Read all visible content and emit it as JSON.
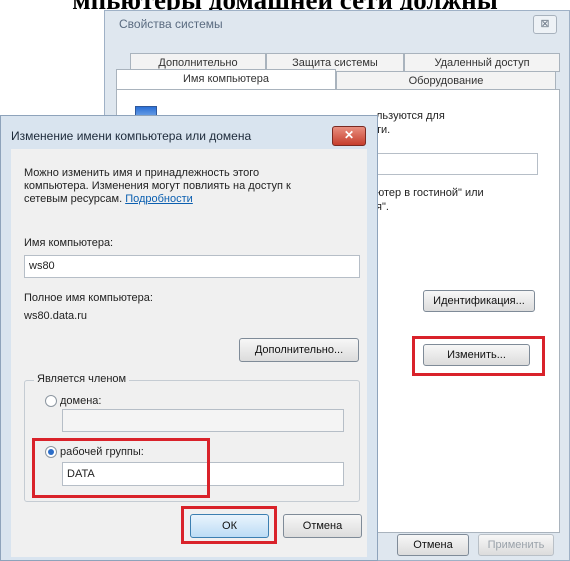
{
  "heading": "мпьютеры домашней сети должны ",
  "back_window": {
    "title": "Свойства системы",
    "close_label": "⊠",
    "tabs_row1": [
      "Дополнительно",
      "Защита системы",
      "Удаленный доступ"
    ],
    "tabs_row2": [
      "Имя компьютера",
      "Оборудование"
    ],
    "desc_line1": "льзуются для",
    "desc_line2": "ти.",
    "example_line1": "ютер в гостиной\" или",
    "example_line2": "я\".",
    "identify_button": "Идентификация...",
    "change_button": "Изменить...",
    "cancel_button": "Отмена",
    "apply_button": "Применить"
  },
  "dialog": {
    "title": "Изменение имени компьютера или домена",
    "close_label": "✕",
    "description_line1": "Можно изменить имя и принадлежность этого",
    "description_line2": "компьютера. Изменения могут повлиять на доступ к",
    "description_line3": "сетевым ресурсам.",
    "details_link": "Подробности",
    "computer_name_label": "Имя компьютера:",
    "computer_name_value": "ws80",
    "full_name_label": "Полное имя компьютера:",
    "full_name_value": "ws80.data.ru",
    "more_button": "Дополнительно...",
    "member_of_label": "Является членом",
    "domain_label": "домена:",
    "domain_value": "",
    "workgroup_label": "рабочей группы:",
    "workgroup_value": "DATA",
    "ok_button": "ОК",
    "cancel_button": "Отмена"
  },
  "highlight_color": "#d9222a"
}
